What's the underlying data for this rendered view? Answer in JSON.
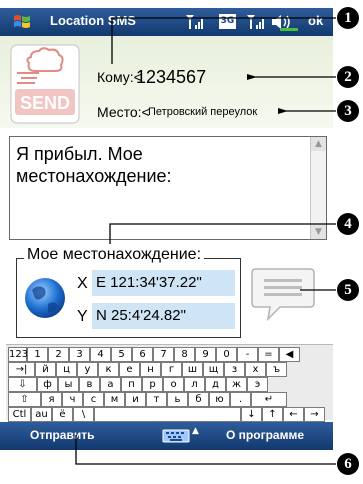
{
  "titlebar": {
    "start_icon": "windows-flag-icon",
    "title": "Location SMS",
    "signal_icon": "signal-strength-icon",
    "network_badge": "3G",
    "volume_icon": "speaker-icon",
    "battery_icon": "battery-icon",
    "ok_label": "ok"
  },
  "compose": {
    "send_button_label": "SEND",
    "to_label": "Кому:<",
    "to_value": "1234567",
    "place_label": "Место:<",
    "place_value": "Петровский переулок",
    "message_line1": "Я прибыл. Мое",
    "message_line2": "местонахождение:"
  },
  "location": {
    "title": "Мое местонахождение:",
    "x_label": "X",
    "x_value": "E 121:34'37.22\"",
    "y_label": "Y",
    "y_value": "N 25:4'24.82\"",
    "globe_icon": "globe-icon",
    "chat_icon": "message-bubble-icon"
  },
  "keyboard": {
    "rows": [
      [
        "123",
        "1",
        "2",
        "3",
        "4",
        "5",
        "6",
        "7",
        "8",
        "9",
        "0",
        "-",
        "=",
        "◀"
      ],
      [
        "→|",
        "й",
        "ц",
        "у",
        "к",
        "е",
        "н",
        "г",
        "ш",
        "щ",
        "з",
        "х",
        "ъ"
      ],
      [
        "⇩",
        "ф",
        "ы",
        "в",
        "а",
        "п",
        "р",
        "о",
        "л",
        "д",
        "ж",
        "э"
      ],
      [
        "⇧",
        "я",
        "ч",
        "с",
        "м",
        "и",
        "т",
        "ь",
        "б",
        "ю",
        ".",
        "↵"
      ],
      [
        "Ctl",
        "au",
        "ё",
        "\\",
        "",
        "↓",
        "↑",
        "←",
        "→"
      ]
    ]
  },
  "menubar": {
    "left_softkey": "Отправить",
    "right_softkey": "О программе",
    "keyboard_icon": "keyboard-icon"
  },
  "callouts": [
    "1",
    "2",
    "3",
    "4",
    "5",
    "6"
  ],
  "colors": {
    "bar_top": "#2f5d9b",
    "bar_bottom": "#12396f",
    "coord_bg": "#cfe4f4",
    "send_red": "#e08b86"
  }
}
